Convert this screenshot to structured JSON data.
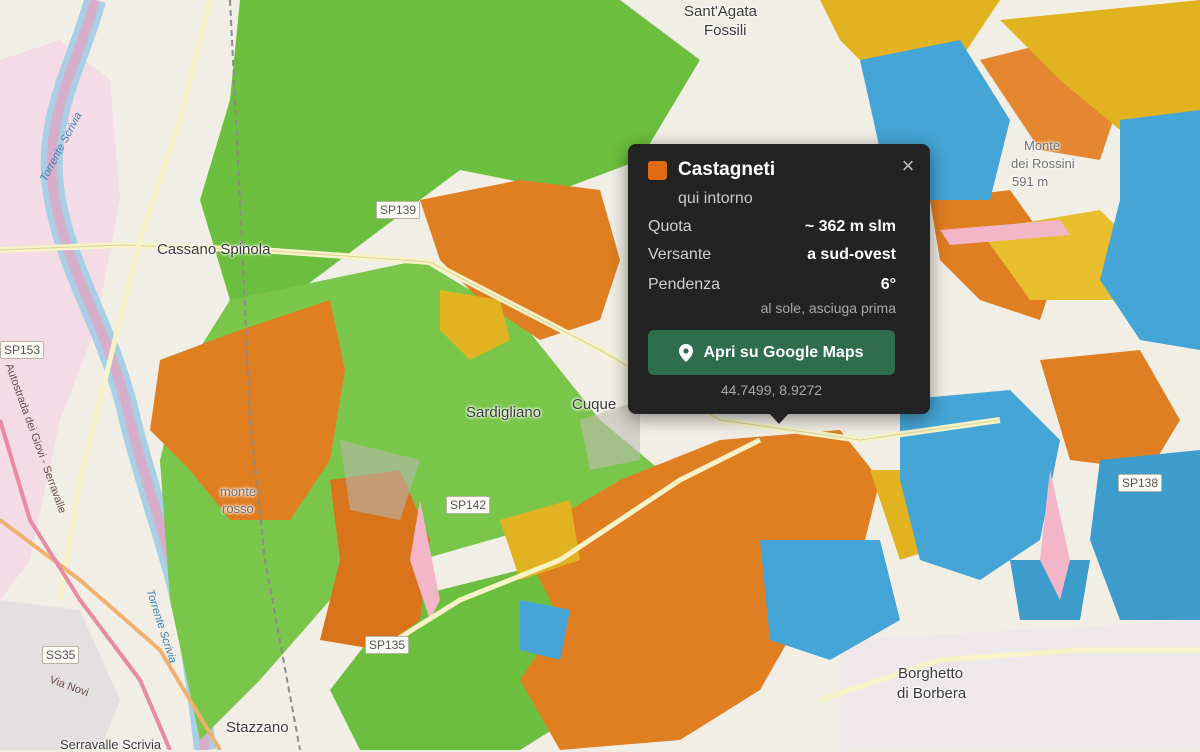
{
  "map": {
    "places": {
      "sant_agata": "Sant'Agata",
      "fossili": "Fossili",
      "cassano_spinola": "Cassano Spinola",
      "sardigliano": "Sardigliano",
      "cuque": "Cuque",
      "monte_rosso_1": "monte",
      "monte_rosso_2": "rosso",
      "stazzano": "Stazzano",
      "borghetto_1": "Borghetto",
      "borghetto_2": "di Borbera",
      "monte_dei_rossi_1": "Monte",
      "monte_dei_rossi_2": "dei Rossini",
      "monte_dei_rossi_3": "591 m",
      "serravalle": "Serravalle Scrivia"
    },
    "roads": {
      "sp139": "SP139",
      "sp153": "SP153",
      "sp142": "SP142",
      "sp135": "SP135",
      "sp138": "SP138",
      "ss35": "SS35"
    },
    "waterways": {
      "torrente_scrivia_top": "Torrente Scrivia",
      "torrente_scrivia_bottom": "Torrente Scrivia"
    },
    "highway_label": "Autostrada dei Giovi - Serravalle",
    "via_novi": "Via Novi",
    "colors": {
      "chestnut": "#e07e22",
      "broadleaf": "#6cbf3e",
      "beech": "#45a5d6",
      "oak": "#e2b320",
      "meadow": "#f2b6c8"
    }
  },
  "popup": {
    "title": "Castagneti",
    "subtitle": "qui intorno",
    "swatch_color": "#e06a12",
    "close_icon": "×",
    "rows": [
      {
        "label": "Quota",
        "value": "~ 362 m slm"
      },
      {
        "label": "Versante",
        "value": "a sud-ovest"
      },
      {
        "label": "Pendenza",
        "value": "6°"
      }
    ],
    "note": "al sole, asciuga prima",
    "button_label": "Apri su Google Maps",
    "button_icon": "map-pin-icon",
    "coords": "44.7499, 8.9272"
  }
}
